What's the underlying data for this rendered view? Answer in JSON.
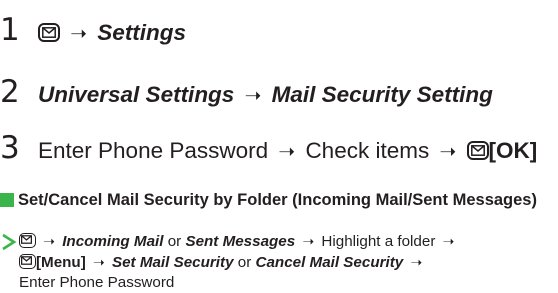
{
  "steps": [
    {
      "number": "1",
      "parts": [
        "Settings"
      ]
    },
    {
      "number": "2",
      "parts": [
        "Universal Settings",
        "Mail Security Setting"
      ]
    },
    {
      "number": "3",
      "parts": [
        "Enter Phone Password",
        "Check items",
        "[OK]"
      ]
    }
  ],
  "section": {
    "heading": "Set/Cancel Mail Security by Folder (Incoming Mail/Sent Messages)",
    "incoming": "Incoming Mail",
    "or1": "or",
    "sent": "Sent Messages",
    "highlight": "Highlight a folder",
    "menu": "[Menu]",
    "set": "Set Mail Security",
    "or2": "or",
    "cancel": "Cancel Mail Security",
    "enter": "Enter Phone Password"
  },
  "icons": {
    "mail_key": "mail-key-icon",
    "arrow": "right-arrow-icon",
    "caret": "caret-right-icon",
    "bullet": "green-square-bullet"
  },
  "colors": {
    "text": "#231f20",
    "accent_square": "#3bb54a",
    "caret": "#3bb54a"
  }
}
